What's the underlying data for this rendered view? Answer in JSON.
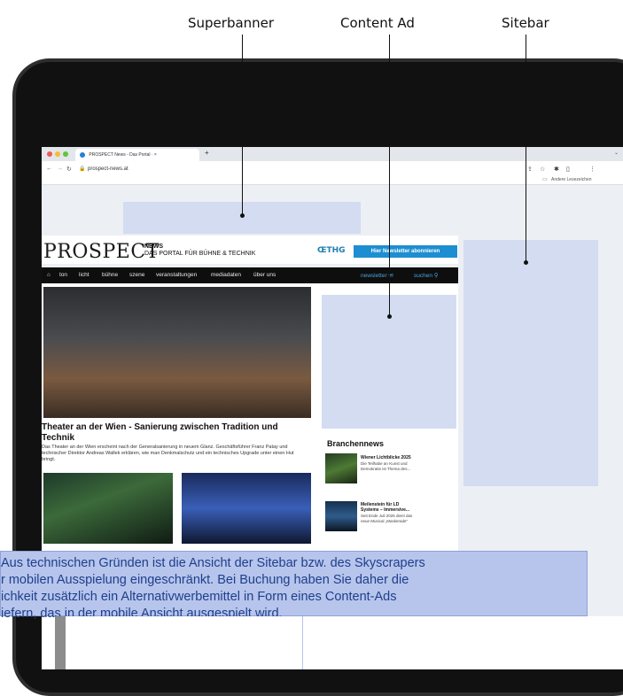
{
  "callouts": {
    "superbanner": "Superbanner",
    "content_ad": "Content Ad",
    "sitebar": "Sitebar"
  },
  "browser": {
    "tab_title": "PROSPECT News - Das Portal · ×",
    "new_tab": "+",
    "url": "prospect-news.at",
    "bookmarks": "Andere Lesezeichen"
  },
  "site": {
    "logo": "PROSPECT",
    "logo_news": "NEWS",
    "logo_tagline": "DAS PORTAL FÜR BÜHNE & TECHNIK",
    "partner": "ŒTHG",
    "newsletter_button": "Hier Newsletter abonnieren",
    "nav": [
      "ton",
      "licht",
      "bühne",
      "szene",
      "veranstaltungen",
      "mediadaten",
      "über uns"
    ],
    "nav_newsletter": "newsletter ✉",
    "nav_search": "suchen ⚲"
  },
  "article": {
    "title": "Theater an der Wien - Sanierung zwischen Tradition und Technik",
    "text": "Das Theater an der Wien erscheint nach der Generalsanierung in neuem Glanz. Geschäftsführer Franz Patay und technischer Direktor Andreas Wallek erklären, wie man Denkmalschutz und ein technisches Upgrade unter einen Hut bringt."
  },
  "branchennews": {
    "title": "Branchennews",
    "items": [
      {
        "headline": "Wiener Lichtblicke 2025",
        "text": "Die Teilhabe an Kunst und Demokratie ist Thema des..."
      },
      {
        "headline": "Meilenstein für LD Systems – Immersive...",
        "text": "Seit Ende Juli 2025 dient das neue Musical „Maskerade\""
      }
    ]
  },
  "note": {
    "lines": [
      "Aus technischen Gründen ist die Ansicht der Sitebar bzw. des Skyscrapers",
      "r mobilen Ausspielung eingeschränkt. Bei Buchung haben Sie daher die",
      "ichkeit zusätzlich ein Alternativwerbemittel in Form eines Content-Ads",
      "iefern, das in der mobile Ansicht ausgespielt wird."
    ]
  },
  "colors": {
    "ad_placeholder": "#d3dcf1",
    "note_bg": "#b7c5ec",
    "note_text": "#1e3f8b",
    "accent": "#1d8ed1"
  }
}
